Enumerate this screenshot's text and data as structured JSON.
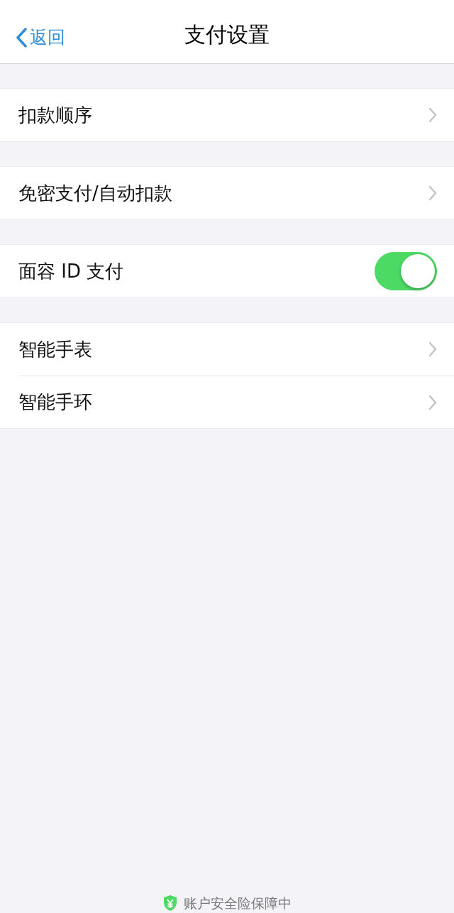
{
  "nav": {
    "back": "返回",
    "title": "支付设置"
  },
  "groups": [
    {
      "rows": [
        {
          "kind": "link",
          "label": "扣款顺序"
        }
      ]
    },
    {
      "rows": [
        {
          "kind": "link",
          "label": "免密支付/自动扣款"
        }
      ]
    },
    {
      "rows": [
        {
          "kind": "switch",
          "label": "面容 ID 支付",
          "on": true
        }
      ]
    },
    {
      "rows": [
        {
          "kind": "link",
          "label": "智能手表"
        },
        {
          "kind": "link",
          "label": "智能手环"
        }
      ]
    }
  ],
  "footer": {
    "text": "账户安全险保障中"
  }
}
